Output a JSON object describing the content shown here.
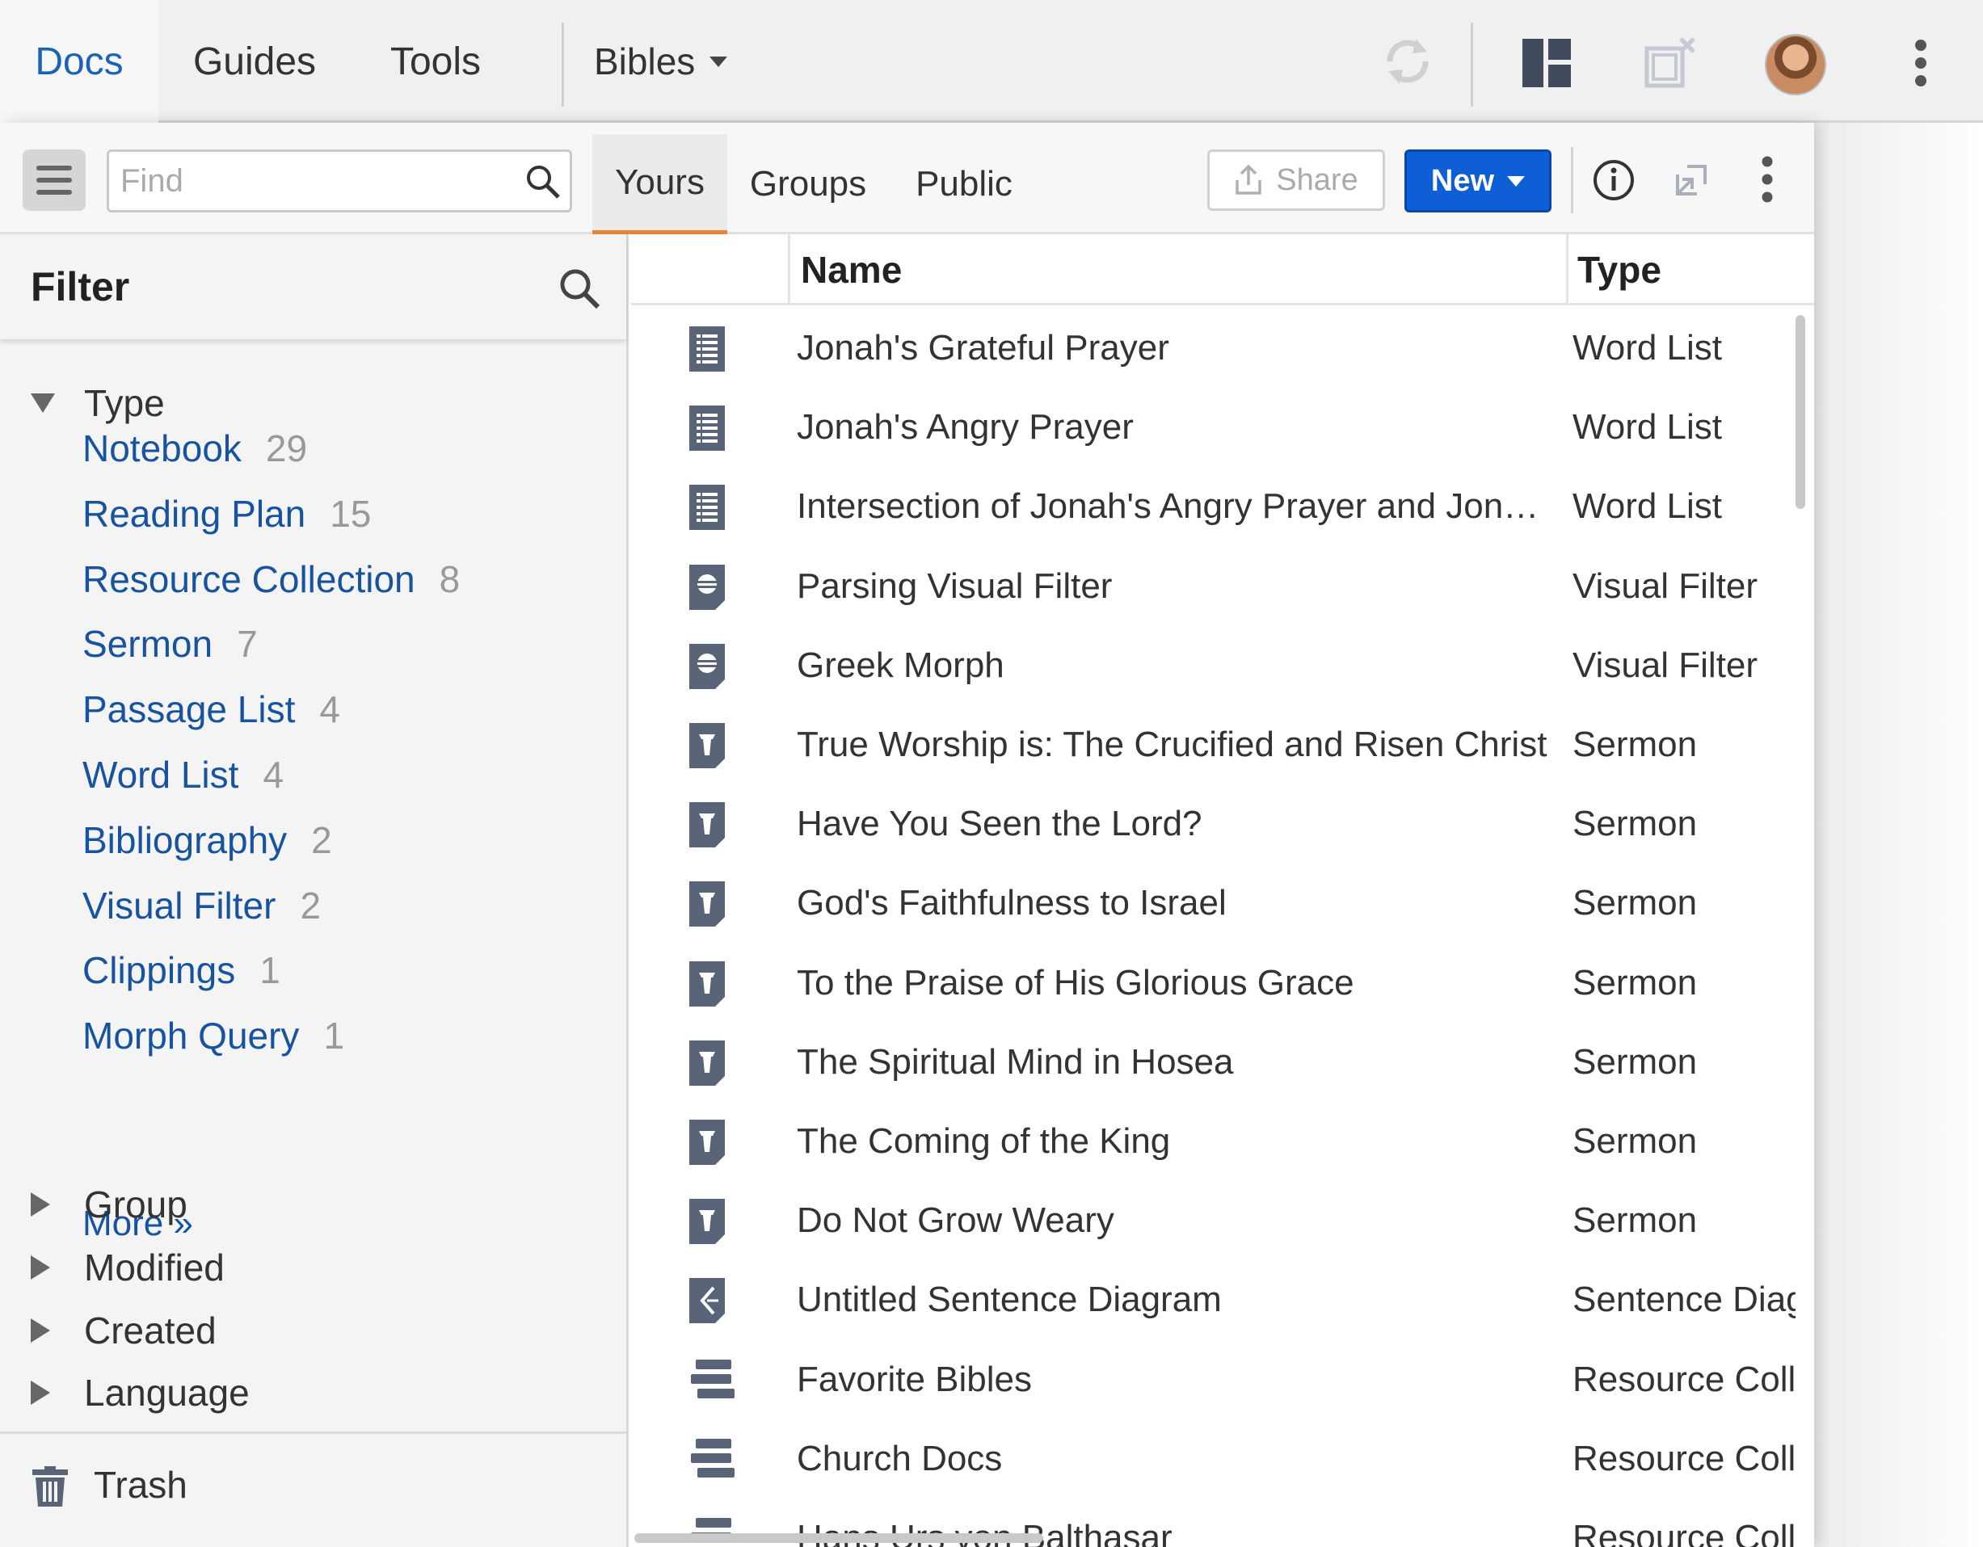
{
  "topbar": {
    "tabs": [
      {
        "label": "Docs",
        "active": true
      },
      {
        "label": "Guides",
        "active": false
      },
      {
        "label": "Tools",
        "active": false
      }
    ],
    "bibles_label": "Bibles",
    "icons": [
      "sync-icon",
      "layout-icon",
      "close-panel-icon",
      "user-avatar",
      "more-vertical-icon"
    ]
  },
  "toolbar": {
    "find_placeholder": "Find",
    "find_value": "",
    "tabs": [
      {
        "label": "Yours",
        "active": true
      },
      {
        "label": "Groups",
        "active": false
      },
      {
        "label": "Public",
        "active": false
      }
    ],
    "share_label": "Share",
    "new_label": "New"
  },
  "filter": {
    "title": "Filter",
    "type_label": "Type",
    "type_items": [
      {
        "label": "Notebook",
        "count": "29"
      },
      {
        "label": "Reading Plan",
        "count": "15"
      },
      {
        "label": "Resource Collection",
        "count": "8"
      },
      {
        "label": "Sermon",
        "count": "7"
      },
      {
        "label": "Passage List",
        "count": "4"
      },
      {
        "label": "Word List",
        "count": "4"
      },
      {
        "label": "Bibliography",
        "count": "2"
      },
      {
        "label": "Visual Filter",
        "count": "2"
      },
      {
        "label": "Clippings",
        "count": "1"
      },
      {
        "label": "Morph Query",
        "count": "1"
      }
    ],
    "more_label": "More »",
    "collapsed_facets": [
      "Group",
      "Modified",
      "Created",
      "Language"
    ],
    "trash_label": "Trash"
  },
  "list": {
    "columns": {
      "name": "Name",
      "type": "Type"
    },
    "rows": [
      {
        "name": "Jonah's Grateful Prayer",
        "type": "Word List",
        "icon": "word-list-icon"
      },
      {
        "name": "Jonah's Angry Prayer",
        "type": "Word List",
        "icon": "word-list-icon"
      },
      {
        "name": "Intersection of Jonah's Angry Prayer and Jona…",
        "type": "Word List",
        "icon": "word-list-icon"
      },
      {
        "name": "Parsing Visual Filter",
        "type": "Visual Filter",
        "icon": "visual-filter-icon"
      },
      {
        "name": "Greek Morph",
        "type": "Visual Filter",
        "icon": "visual-filter-icon"
      },
      {
        "name": "True Worship is: The Crucified and Risen Christ",
        "type": "Sermon",
        "icon": "sermon-icon"
      },
      {
        "name": "Have You Seen the Lord?",
        "type": "Sermon",
        "icon": "sermon-icon"
      },
      {
        "name": "God's Faithfulness to Israel",
        "type": "Sermon",
        "icon": "sermon-icon"
      },
      {
        "name": "To the Praise of His Glorious Grace",
        "type": "Sermon",
        "icon": "sermon-icon"
      },
      {
        "name": "The Spiritual Mind in Hosea",
        "type": "Sermon",
        "icon": "sermon-icon"
      },
      {
        "name": "The Coming of the King",
        "type": "Sermon",
        "icon": "sermon-icon"
      },
      {
        "name": "Do Not Grow Weary",
        "type": "Sermon",
        "icon": "sermon-icon"
      },
      {
        "name": "Untitled Sentence Diagram",
        "type": "Sentence Diag",
        "icon": "sentence-diagram-icon"
      },
      {
        "name": "Favorite Bibles",
        "type": "Resource Colle",
        "icon": "resource-collection-icon"
      },
      {
        "name": "Church Docs",
        "type": "Resource Colle",
        "icon": "resource-collection-icon"
      },
      {
        "name": "Hans Urs von Balthasar",
        "type": "Resource Colle",
        "icon": "resource-collection-icon"
      }
    ]
  },
  "colors": {
    "accent_blue": "#1a63b8",
    "link_blue": "#17539e",
    "new_button": "#0e5fd6",
    "active_tab_underline": "#e8833a",
    "icon_slate": "#5a6478"
  }
}
